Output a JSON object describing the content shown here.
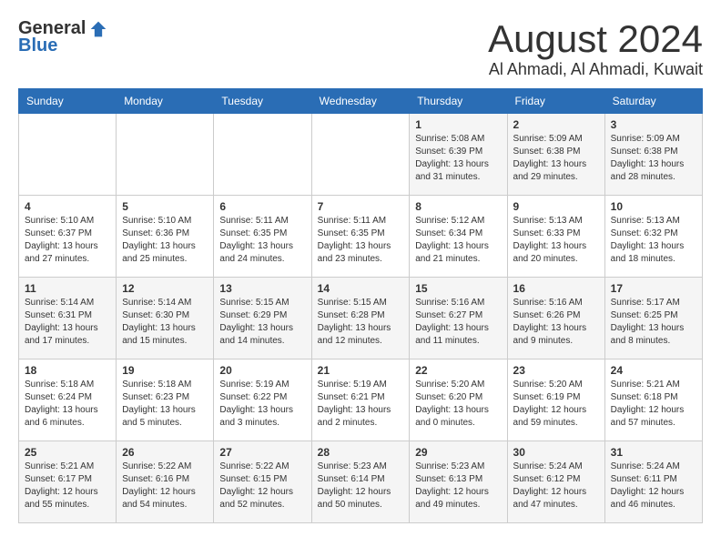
{
  "logo": {
    "general": "General",
    "blue": "Blue"
  },
  "title": {
    "month_year": "August 2024",
    "location": "Al Ahmadi, Al Ahmadi, Kuwait"
  },
  "days_of_week": [
    "Sunday",
    "Monday",
    "Tuesday",
    "Wednesday",
    "Thursday",
    "Friday",
    "Saturday"
  ],
  "weeks": [
    [
      {
        "day": "",
        "info": ""
      },
      {
        "day": "",
        "info": ""
      },
      {
        "day": "",
        "info": ""
      },
      {
        "day": "",
        "info": ""
      },
      {
        "day": "1",
        "info": "Sunrise: 5:08 AM\nSunset: 6:39 PM\nDaylight: 13 hours and 31 minutes."
      },
      {
        "day": "2",
        "info": "Sunrise: 5:09 AM\nSunset: 6:38 PM\nDaylight: 13 hours and 29 minutes."
      },
      {
        "day": "3",
        "info": "Sunrise: 5:09 AM\nSunset: 6:38 PM\nDaylight: 13 hours and 28 minutes."
      }
    ],
    [
      {
        "day": "4",
        "info": "Sunrise: 5:10 AM\nSunset: 6:37 PM\nDaylight: 13 hours and 27 minutes."
      },
      {
        "day": "5",
        "info": "Sunrise: 5:10 AM\nSunset: 6:36 PM\nDaylight: 13 hours and 25 minutes."
      },
      {
        "day": "6",
        "info": "Sunrise: 5:11 AM\nSunset: 6:35 PM\nDaylight: 13 hours and 24 minutes."
      },
      {
        "day": "7",
        "info": "Sunrise: 5:11 AM\nSunset: 6:35 PM\nDaylight: 13 hours and 23 minutes."
      },
      {
        "day": "8",
        "info": "Sunrise: 5:12 AM\nSunset: 6:34 PM\nDaylight: 13 hours and 21 minutes."
      },
      {
        "day": "9",
        "info": "Sunrise: 5:13 AM\nSunset: 6:33 PM\nDaylight: 13 hours and 20 minutes."
      },
      {
        "day": "10",
        "info": "Sunrise: 5:13 AM\nSunset: 6:32 PM\nDaylight: 13 hours and 18 minutes."
      }
    ],
    [
      {
        "day": "11",
        "info": "Sunrise: 5:14 AM\nSunset: 6:31 PM\nDaylight: 13 hours and 17 minutes."
      },
      {
        "day": "12",
        "info": "Sunrise: 5:14 AM\nSunset: 6:30 PM\nDaylight: 13 hours and 15 minutes."
      },
      {
        "day": "13",
        "info": "Sunrise: 5:15 AM\nSunset: 6:29 PM\nDaylight: 13 hours and 14 minutes."
      },
      {
        "day": "14",
        "info": "Sunrise: 5:15 AM\nSunset: 6:28 PM\nDaylight: 13 hours and 12 minutes."
      },
      {
        "day": "15",
        "info": "Sunrise: 5:16 AM\nSunset: 6:27 PM\nDaylight: 13 hours and 11 minutes."
      },
      {
        "day": "16",
        "info": "Sunrise: 5:16 AM\nSunset: 6:26 PM\nDaylight: 13 hours and 9 minutes."
      },
      {
        "day": "17",
        "info": "Sunrise: 5:17 AM\nSunset: 6:25 PM\nDaylight: 13 hours and 8 minutes."
      }
    ],
    [
      {
        "day": "18",
        "info": "Sunrise: 5:18 AM\nSunset: 6:24 PM\nDaylight: 13 hours and 6 minutes."
      },
      {
        "day": "19",
        "info": "Sunrise: 5:18 AM\nSunset: 6:23 PM\nDaylight: 13 hours and 5 minutes."
      },
      {
        "day": "20",
        "info": "Sunrise: 5:19 AM\nSunset: 6:22 PM\nDaylight: 13 hours and 3 minutes."
      },
      {
        "day": "21",
        "info": "Sunrise: 5:19 AM\nSunset: 6:21 PM\nDaylight: 13 hours and 2 minutes."
      },
      {
        "day": "22",
        "info": "Sunrise: 5:20 AM\nSunset: 6:20 PM\nDaylight: 13 hours and 0 minutes."
      },
      {
        "day": "23",
        "info": "Sunrise: 5:20 AM\nSunset: 6:19 PM\nDaylight: 12 hours and 59 minutes."
      },
      {
        "day": "24",
        "info": "Sunrise: 5:21 AM\nSunset: 6:18 PM\nDaylight: 12 hours and 57 minutes."
      }
    ],
    [
      {
        "day": "25",
        "info": "Sunrise: 5:21 AM\nSunset: 6:17 PM\nDaylight: 12 hours and 55 minutes."
      },
      {
        "day": "26",
        "info": "Sunrise: 5:22 AM\nSunset: 6:16 PM\nDaylight: 12 hours and 54 minutes."
      },
      {
        "day": "27",
        "info": "Sunrise: 5:22 AM\nSunset: 6:15 PM\nDaylight: 12 hours and 52 minutes."
      },
      {
        "day": "28",
        "info": "Sunrise: 5:23 AM\nSunset: 6:14 PM\nDaylight: 12 hours and 50 minutes."
      },
      {
        "day": "29",
        "info": "Sunrise: 5:23 AM\nSunset: 6:13 PM\nDaylight: 12 hours and 49 minutes."
      },
      {
        "day": "30",
        "info": "Sunrise: 5:24 AM\nSunset: 6:12 PM\nDaylight: 12 hours and 47 minutes."
      },
      {
        "day": "31",
        "info": "Sunrise: 5:24 AM\nSunset: 6:11 PM\nDaylight: 12 hours and 46 minutes."
      }
    ]
  ]
}
